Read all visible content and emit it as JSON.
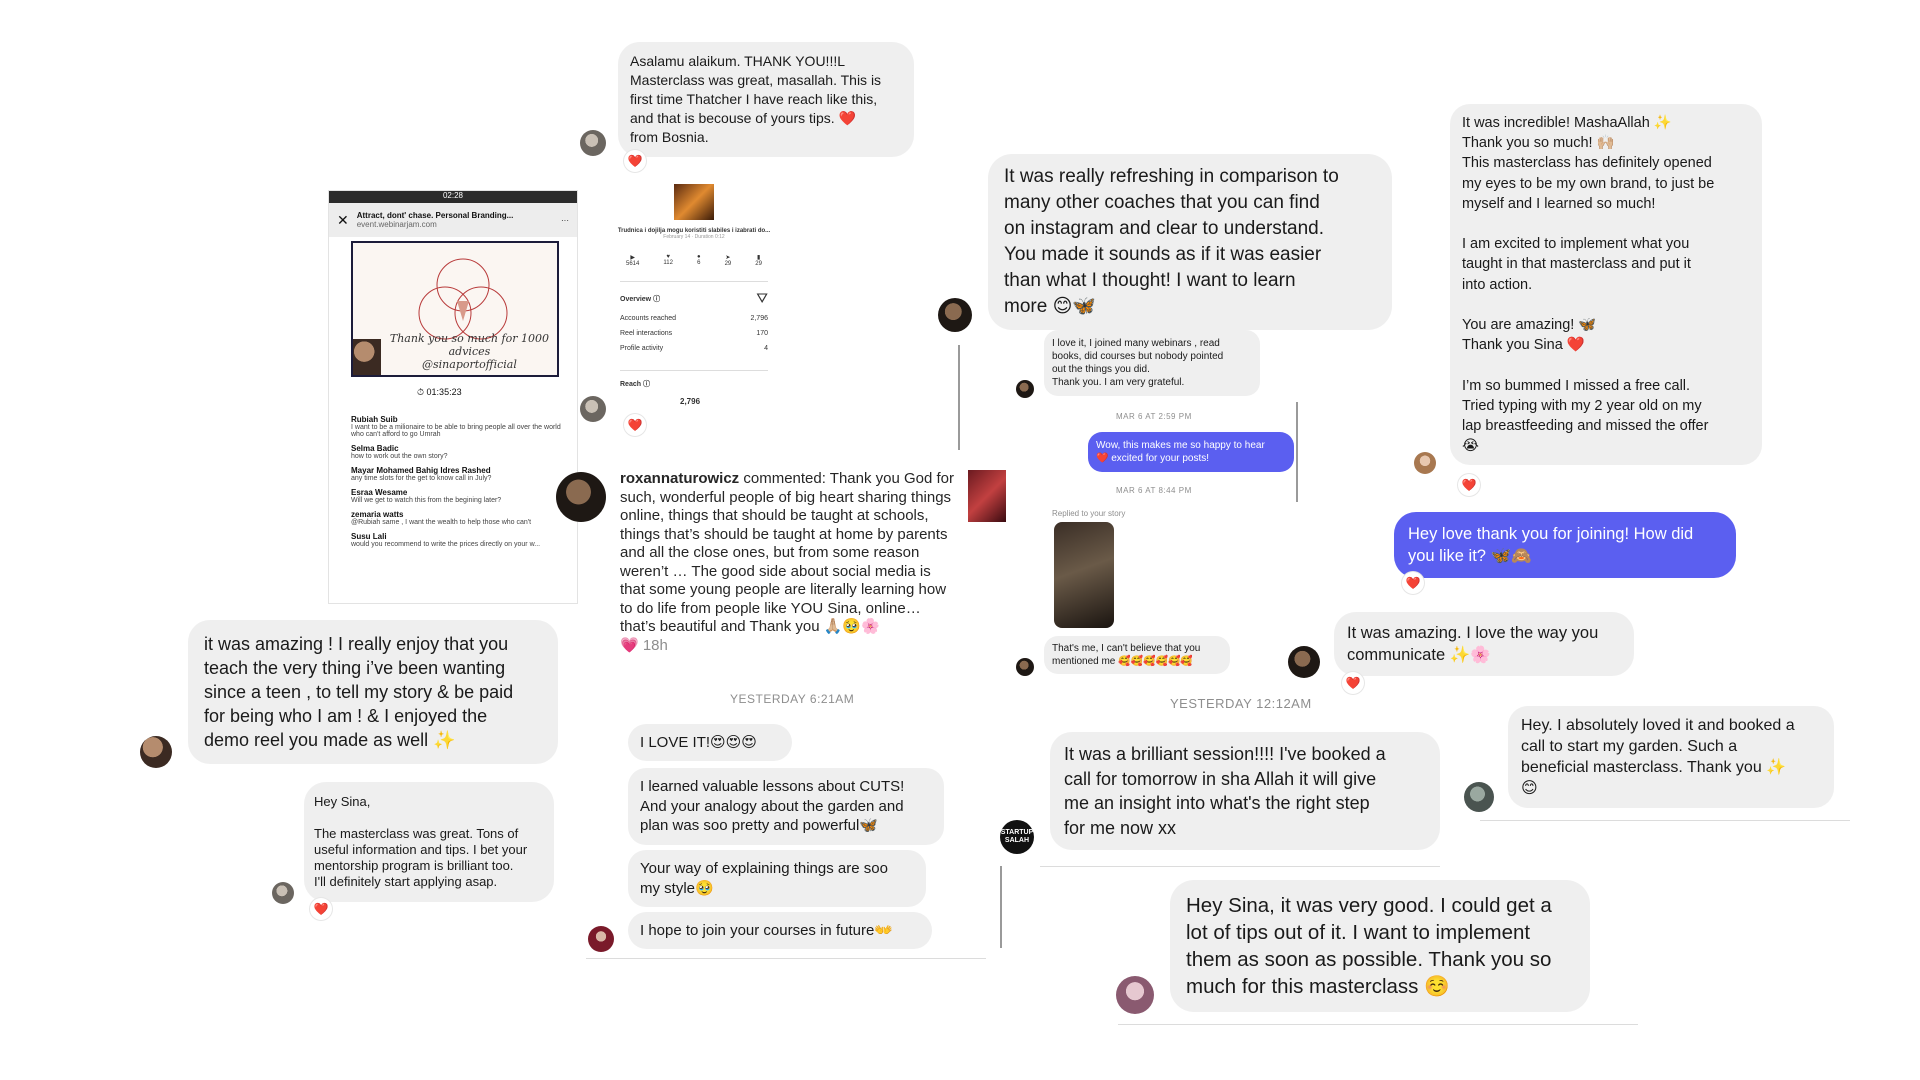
{
  "msg_bosnia": {
    "text": "Asalamu alaikum. THANK YOU!!!L\nMasterclass was great, masallah. This is\nfirst time Thatcher I have reach like this,\nand that is becouse of yours tips.  ❤️\nfrom Bosnia."
  },
  "msg_refreshing": {
    "text": "It was really refreshing in comparison to\nmany other coaches that you can find\non instagram and clear to understand.\nYou made it sounds as if it was easier\nthan what I thought! I want to learn\nmore 😊🦋"
  },
  "msg_incredible": {
    "text": "It was incredible! MashaAllah ✨\nThank you so much! 🙌🏼\nThis masterclass has definitely opened\nmy eyes to be my own brand, to just be\nmyself and I learned so much!\n\nI am excited to implement what you\ntaught in that masterclass and put it\ninto action.\n\nYou are amazing! 🦋\nThank you Sina ❤️\n\nI’m so bummed I missed a free call.\nTried typing with my 2 year old on my\nlap breastfeeding and missed the offer\n😭"
  },
  "phone": {
    "status_time": "02:28",
    "page_title": "Attract, dont' chase. Personal Branding...",
    "url": "event.webinarjam.com",
    "slide_text": "Thank you so much for 1000\nadvices\n@sinaportofficial",
    "timer": "01:35:23",
    "comments": [
      {
        "name": "Rubiah Suib",
        "text": "I want to be a milionaire to be able to bring people all over the world who can't afford to go Umrah"
      },
      {
        "name": "Selma Badic",
        "text": "how to work out the own story?"
      },
      {
        "name": "Mayar Mohamed Bahig Idres Rashed",
        "text": "any time slots for the get to know call in July?"
      },
      {
        "name": "Esraa Wesame",
        "text": "Will we get to watch this from the begining later?"
      },
      {
        "name": "zemaria watts",
        "text": "@Rubiah same , I want the wealth to help those who can't"
      },
      {
        "name": "Susu Lali",
        "text": "would you recommend to write the prices directly on your w..."
      }
    ]
  },
  "insights": {
    "caption": "Trudnica i dojilja mogu koristiti slabiles i izabrati do...",
    "date": "February 14 · Duration 0:12",
    "stats": [
      "5614",
      "112",
      "6",
      "29",
      "29"
    ],
    "overview_label": "Overview ⓘ",
    "rows": [
      {
        "label": "Accounts reached",
        "value": "2,796"
      },
      {
        "label": "Reel interactions",
        "value": "170"
      },
      {
        "label": "Profile activity",
        "value": "4"
      }
    ],
    "reach_label": "Reach ⓘ",
    "reach_value": "2,796"
  },
  "msg_webinars": {
    "text": "I love it, I joined many webinars , read\nbooks, did courses but nobody pointed\nout the things you did.\nThank you. I am very grateful."
  },
  "ts_mar6_1": "MAR 6 AT 2:59 PM",
  "msg_happy": {
    "text": "Wow, this makes me so happy to hear\n❤️ excited for your posts!"
  },
  "ts_mar6_2": "MAR 6 AT 8:44 PM",
  "replied_story": "Replied to your story",
  "msg_thats_me": {
    "text": "That's me, I can't believe that you\nmentioned me 🥰🥰🥰🥰🥰🥰"
  },
  "msg_love_thanks": {
    "text": "Hey love thank you for joining! How did\nyou like it? 🦋🙈"
  },
  "msg_amazing_communicate": {
    "text": "It was amazing. I love the way you\ncommunicate ✨🌸"
  },
  "roxanna": {
    "username": "roxannaturowicz",
    "text": " commented: Thank you God for such, wonderful  people of big heart sharing things online, things that should be taught at schools, things that’s should be taught at home by parents and all the close ones, but from some reason weren’t … The good side about social media is that some young people are literally learning how to do life from people like YOU Sina, online… that’s beautiful and Thank you 🙏🏼🥹🌸",
    "meta": "💗 18h"
  },
  "msg_teen": {
    "text": "it was amazing ! I really enjoy that you\nteach the very thing i’ve been wanting\nsince a teen , to tell my story & be paid\nfor being who I am ! & I enjoyed the\ndemo reel you made as well ✨"
  },
  "ts_yesterday_621": "YESTERDAY 6:21AM",
  "msg_love_it": {
    "text": "I LOVE IT!😍😍😍"
  },
  "msg_cuts": {
    "text": "I learned valuable lessons about CUTS!\nAnd your analogy about the garden and\nplan was soo pretty and powerful🦋"
  },
  "msg_explaining": {
    "text": "Your way of explaining things are soo\nmy style🥹"
  },
  "msg_courses": {
    "text": "I hope to join your courses in future👐"
  },
  "ts_yesterday_12": "YESTERDAY 12:12AM",
  "msg_brilliant": {
    "text": "It was a brilliant session!!!! I've booked a\ncall for tomorrow in sha Allah it will give\nme an insight into what's the right step\nfor me now xx"
  },
  "msg_garden": {
    "text": "Hey. I absolutely loved it and booked a\ncall to start my garden. Such a\nbeneficial masterclass. Thank you ✨\n😊"
  },
  "msg_hey_sina_small": {
    "text": "Hey Sina,\n\nThe masterclass was great. Tons of\nuseful information and tips. I bet your\nmentorship program is brilliant too.\nI'll definitely start applying asap."
  },
  "msg_very_good": {
    "text": "Hey Sina, it was very good. I could get a\nlot of tips out of it. I want to implement\nthem as soon as possible. Thank you so\nmuch for this masterclass ☺️"
  },
  "heart_glyph": "❤️",
  "avatar_logo_text": "STARTUP\nSALAH",
  "colors": {
    "bubble_grey": "#efefef",
    "bubble_blue": "#5b5ff0",
    "timestamp": "#8e8e8e"
  }
}
